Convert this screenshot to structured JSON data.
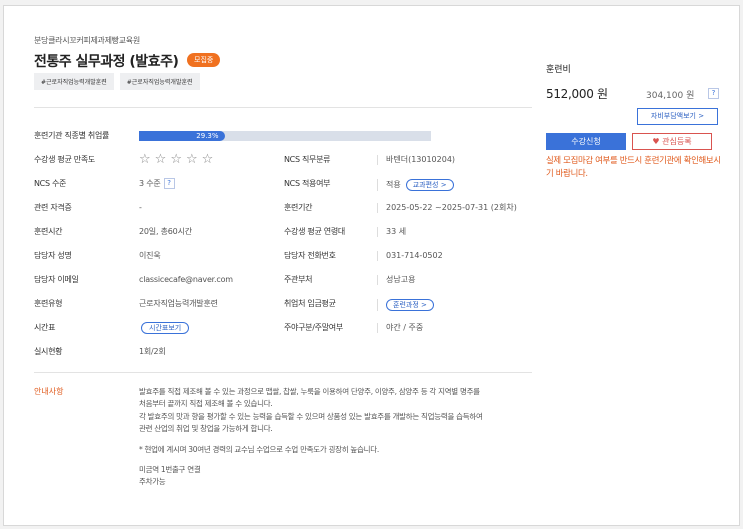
{
  "course": {
    "institution": "분당클라시꼬커피제과제빵교육원",
    "title": "전통주 실무과정 (발효주)",
    "badge": "모집중",
    "tags": [
      "#근로자직업능력개발훈련",
      "#근로자직업능력개발훈련"
    ]
  },
  "details": {
    "employment_rate_label": "훈련기관 직종별 취업률",
    "employment_rate_value": "29.3%",
    "employment_rate_fraction": 0.293,
    "satisfaction_label": "수강생 평균 만족도",
    "satisfaction_stars": [
      "☆",
      "☆",
      "☆",
      "☆",
      "☆"
    ],
    "ncs_category_label": "NCS 직무분류",
    "ncs_category_value": "바텐더(13010204)",
    "ncs_level_label": "NCS 수준",
    "ncs_level_value": "3 수준",
    "help_mark": "?",
    "ncs_applied_label": "NCS 적용여부",
    "ncs_applied_value": "적용",
    "curriculum_button": "교과편성 >",
    "certificate_label": "관련 자격증",
    "certificate_value": "-",
    "period_label": "훈련기간",
    "period_value": "2025-05-22 ~2025-07-31 (2회차)",
    "hours_label": "훈련시간",
    "hours_value": "20일, 총60시간",
    "avg_age_label": "수강생 평균 연령대",
    "avg_age_value": "33 세",
    "manager_label": "담당자 성명",
    "manager_value": "이진욱",
    "phone_label": "담당자 전화번호",
    "phone_value": "031-714-0502",
    "email_label": "담당자 이메일",
    "email_value": "classicecafe@naver.com",
    "ministry_label": "주관부처",
    "ministry_value": "성남고용",
    "type_label": "훈련유형",
    "type_value": "근로자직업능력개발훈련",
    "wage_label": "취업처 임금평균",
    "wage_button": "훈련과정 >",
    "timetable_label": "시간표",
    "timetable_button": "시간표보기",
    "weekday_label": "주야구분/주말여부",
    "weekday_value": "야간 / 주중",
    "status_label": "실시현황",
    "status_value": "1회/2회"
  },
  "notice": {
    "label": "안내사항",
    "lines": [
      "발효주를 직접 제조해 볼 수 있는 과정으로 맵쌀, 찹쌀, 누룩을 이용하여 단양주, 이양주, 삼양주 등 각 지역별 명주를",
      "처음부터 끝까지 직접 제조해 볼 수 있습니다.",
      "각 발효주의 맛과 향을 평가할 수 있는 능력을 습득할 수 있으며 상품성 있는 발효주를 개발하는 직업능력을 습득하여",
      "관련 산업의 취업 및 창업을 가능하게 합니다.",
      "",
      "* 현업에 계시며 30여년 경력의 교수님 수업으로 수업 만족도가 굉장히 높습니다.",
      "",
      "미금역 1번출구 연결",
      "주차가능"
    ]
  },
  "fee": {
    "title": "훈련비",
    "price": "512,000 원",
    "price_total": "304,100 원",
    "help_mark": "?",
    "self_pay_button": "자비부담액보기 >",
    "apply_button": "수강신청",
    "favorite_button": "관심등록",
    "favorite_icon": "heart-icon",
    "warning": "실제 모집마감 여부를 반드시 훈련기관에 확인해보시기 바랍니다."
  },
  "colors": {
    "accent_blue": "#3a72d9",
    "badge_orange": "#f07120",
    "warning_orange": "#e05a1c",
    "favorite_red": "#d9534f"
  }
}
